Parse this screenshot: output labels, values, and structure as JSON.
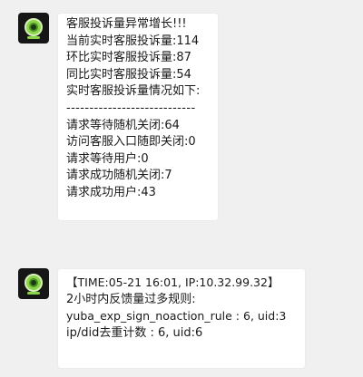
{
  "messages": [
    {
      "avatar_icon": "webcam-icon",
      "lines": [
        "客服投诉量异常增长!!!",
        "当前实时客服投诉量:114",
        "环比实时客服投诉量:87",
        "同比实时客服投诉量:54",
        "实时客服投诉量情况如下:",
        "----------------------------",
        "请求等待随机关闭:64",
        "访问客服入口随即关闭:0",
        "请求等待用户:0",
        "请求成功随机关闭:7",
        "请求成功用户:43"
      ]
    },
    {
      "avatar_icon": "webcam-icon",
      "lines": [
        "【TIME:05-21 16:01, IP:10.32.99.32】",
        "2小时内反馈量过多规则:",
        "yuba_exp_sign_noaction_rule : 6, uid:3",
        "ip/did去重计数 : 6, uid:6"
      ]
    }
  ]
}
